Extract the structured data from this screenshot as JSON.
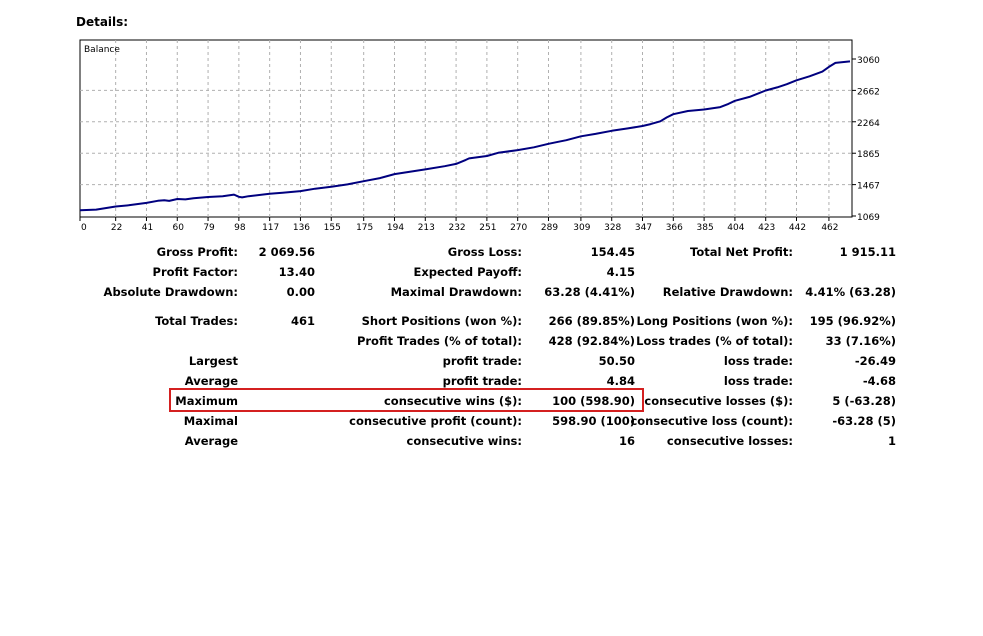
{
  "heading": "Details:",
  "chart_data": {
    "type": "line",
    "legend": "Balance",
    "x_ticks": [
      "0",
      "22",
      "41",
      "60",
      "79",
      "98",
      "117",
      "136",
      "155",
      "175",
      "194",
      "213",
      "232",
      "251",
      "270",
      "289",
      "309",
      "328",
      "347",
      "366",
      "385",
      "404",
      "423",
      "442",
      "462"
    ],
    "y_ticks": [
      "3060",
      "2662",
      "2264",
      "1865",
      "1467",
      "1069"
    ],
    "ylim": [
      1069,
      3060
    ],
    "xlim": [
      0,
      475
    ],
    "line_color": "#00007f",
    "series": [
      {
        "x": [
          0,
          10,
          22,
          30,
          41,
          48,
          52,
          55,
          60,
          65,
          70,
          79,
          88,
          95,
          98,
          100,
          104,
          117,
          125,
          136,
          145,
          155,
          165,
          175,
          185,
          194,
          200,
          213,
          225,
          232,
          238,
          240,
          251,
          258,
          270,
          280,
          289,
          295,
          300,
          309,
          318,
          328,
          338,
          347,
          352,
          358,
          362,
          366,
          375,
          385,
          395,
          400,
          404,
          413,
          423,
          430,
          436,
          442,
          450,
          458,
          462,
          466,
          475
        ],
        "y": [
          1142,
          1150,
          1190,
          1205,
          1235,
          1262,
          1270,
          1260,
          1285,
          1280,
          1295,
          1310,
          1320,
          1340,
          1312,
          1305,
          1320,
          1350,
          1365,
          1385,
          1415,
          1440,
          1470,
          1510,
          1550,
          1600,
          1620,
          1660,
          1700,
          1730,
          1780,
          1800,
          1830,
          1870,
          1905,
          1940,
          1985,
          2010,
          2030,
          2080,
          2110,
          2150,
          2180,
          2210,
          2235,
          2270,
          2320,
          2360,
          2400,
          2420,
          2450,
          2490,
          2530,
          2580,
          2660,
          2700,
          2740,
          2790,
          2840,
          2900,
          2960,
          3010,
          3030
        ]
      }
    ]
  },
  "stats": {
    "gross_profit_label": "Gross Profit:",
    "gross_profit": "2 069.56",
    "gross_loss_label": "Gross Loss:",
    "gross_loss": "154.45",
    "total_net_profit_label": "Total Net Profit:",
    "total_net_profit": "1 915.11",
    "profit_factor_label": "Profit Factor:",
    "profit_factor": "13.40",
    "expected_payoff_label": "Expected Payoff:",
    "expected_payoff": "4.15",
    "absolute_drawdown_label": "Absolute Drawdown:",
    "absolute_drawdown": "0.00",
    "maximal_drawdown_label": "Maximal Drawdown:",
    "maximal_drawdown": "63.28 (4.41%)",
    "relative_drawdown_label": "Relative Drawdown:",
    "relative_drawdown": "4.41% (63.28)",
    "total_trades_label": "Total Trades:",
    "total_trades": "461",
    "short_positions_label": "Short Positions (won %):",
    "short_positions": "266 (89.85%)",
    "long_positions_label": "Long Positions (won %):",
    "long_positions": "195 (96.92%)",
    "profit_trades_label": "Profit Trades (% of total):",
    "profit_trades": "428 (92.84%)",
    "loss_trades_label": "Loss trades (% of total):",
    "loss_trades": "33 (7.16%)",
    "largest_label": "Largest",
    "largest_profit_label": "profit trade:",
    "largest_profit": "50.50",
    "largest_loss_label": "loss trade:",
    "largest_loss": "-26.49",
    "average_label": "Average",
    "average_profit_label": "profit trade:",
    "average_profit": "4.84",
    "average_loss_label": "loss trade:",
    "average_loss": "-4.68",
    "maximum_label": "Maximum",
    "max_cons_wins_label": "consecutive wins ($):",
    "max_cons_wins": "100 (598.90)",
    "max_cons_losses_label": "consecutive losses ($):",
    "max_cons_losses": "5 (-63.28)",
    "maximal_label": "Maximal",
    "maximal_cons_profit_label": "consecutive profit (count):",
    "maximal_cons_profit": "598.90 (100)",
    "maximal_cons_loss_label": "consecutive loss (count):",
    "maximal_cons_loss": "-63.28 (5)",
    "average2_label": "Average",
    "avg_cons_wins_label": "consecutive wins:",
    "avg_cons_wins": "16",
    "avg_cons_losses_label": "consecutive losses:",
    "avg_cons_losses": "1"
  }
}
